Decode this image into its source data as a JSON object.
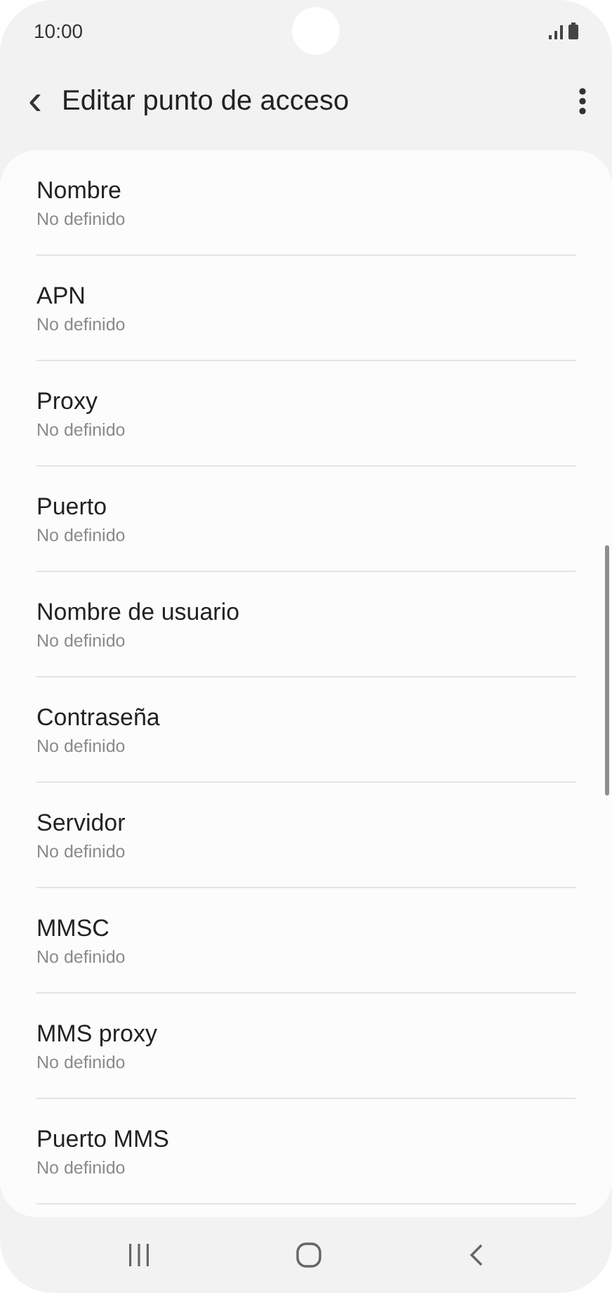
{
  "status_bar": {
    "time": "10:00"
  },
  "header": {
    "back": "‹",
    "title": "Editar punto de acceso"
  },
  "settings": [
    {
      "title": "Nombre",
      "value": "No definido"
    },
    {
      "title": "APN",
      "value": "No definido"
    },
    {
      "title": "Proxy",
      "value": "No definido"
    },
    {
      "title": "Puerto",
      "value": "No definido"
    },
    {
      "title": "Nombre de usuario",
      "value": "No definido"
    },
    {
      "title": "Contraseña",
      "value": "No definido"
    },
    {
      "title": "Servidor",
      "value": "No definido"
    },
    {
      "title": "MMSC",
      "value": "No definido"
    },
    {
      "title": "MMS proxy",
      "value": "No definido"
    },
    {
      "title": "Puerto MMS",
      "value": "No definido"
    }
  ]
}
